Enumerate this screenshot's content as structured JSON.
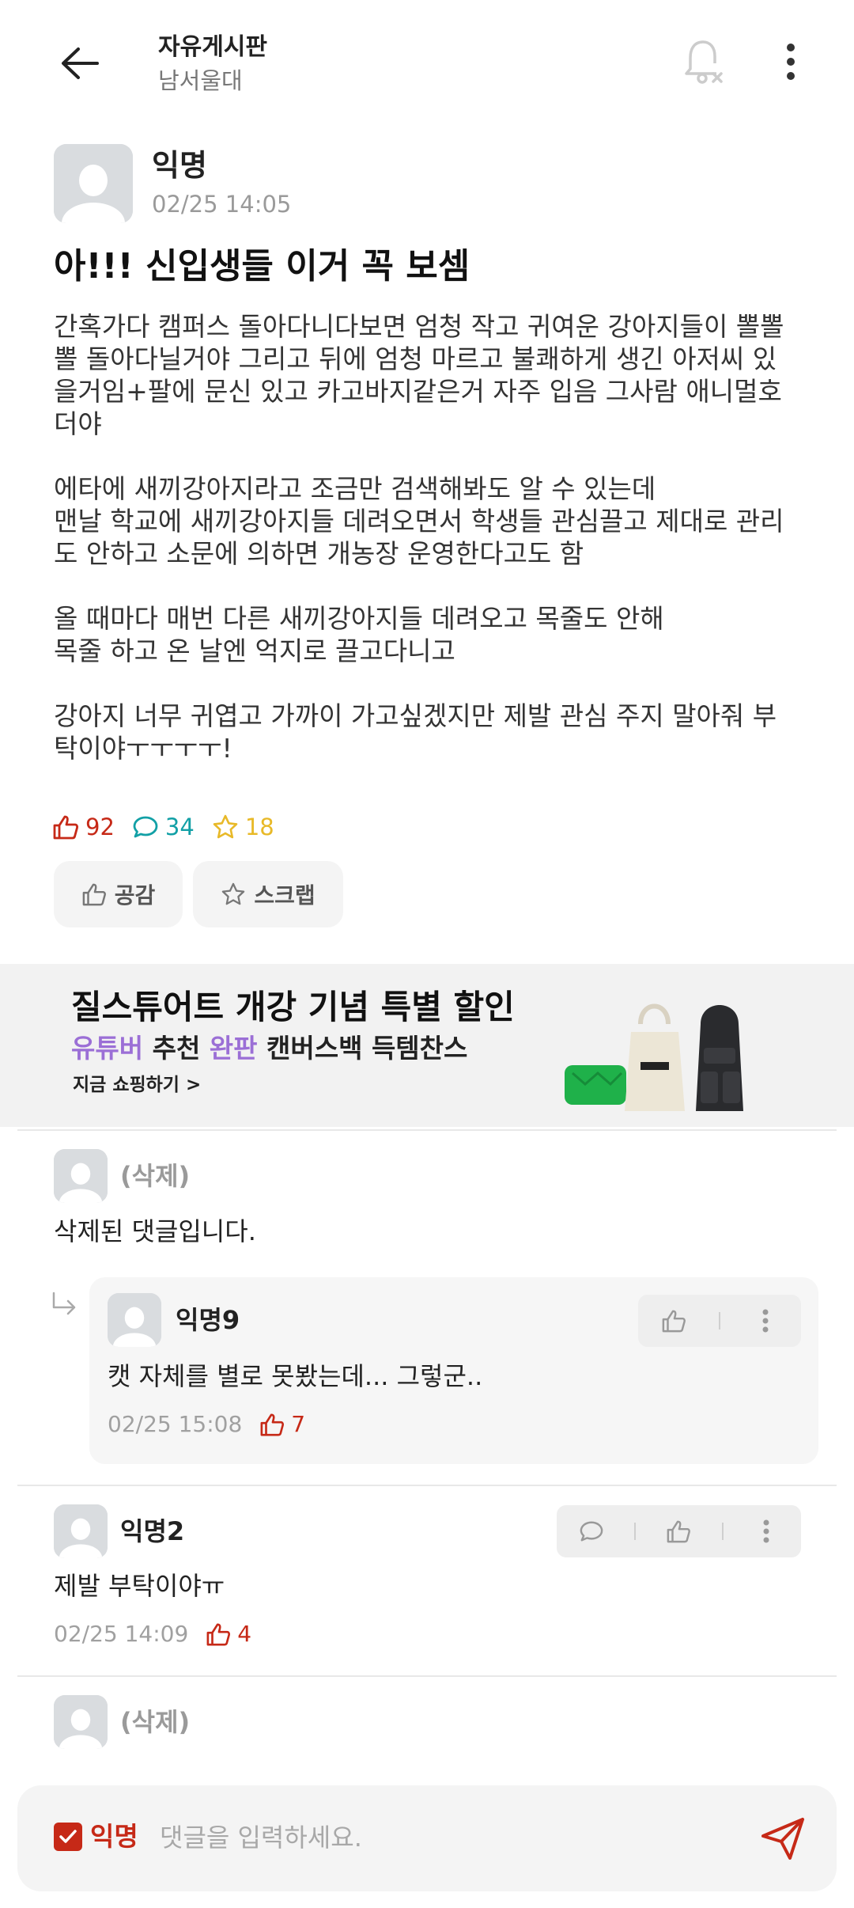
{
  "header": {
    "title": "자유게시판",
    "subtitle": "남서울대"
  },
  "post": {
    "author": "익명",
    "time": "02/25 14:05",
    "title": "아!!! 신입생들 이거 꼭 보셈",
    "body": "간혹가다 캠퍼스 돌아다니다보면 엄청 작고 귀여운 강아지들이 뽈뽈\n뽈 돌아다닐거야 그리고 뒤에 엄청 마르고 불쾌하게 생긴 아저씨 있\n을거임+팔에 문신 있고 카고바지같은거 자주 입음 그사람 애니멀호\n더야\n\n에타에 새끼강아지라고 조금만 검색해봐도 알 수 있는데\n맨날 학교에 새끼강아지들 데려오면서 학생들 관심끌고 제대로 관리\n도 안하고 소문에 의하면 개농장 운영한다고도 함\n\n올 때마다 매번 다른 새끼강아지들 데려오고 목줄도 안해\n목줄 하고 온 날엔 억지로 끌고다니고\n\n강아지 너무 귀엽고 가까이 가고싶겠지만 제발 관심 주지 말아줘 부\n탁이야ㅜㅜㅜㅜ!",
    "likes": "92",
    "comments": "34",
    "scraps": "18",
    "like_button": "공감",
    "scrap_button": "스크랩"
  },
  "ad": {
    "title": "질스튜어트 개강 기념 특별 할인",
    "sub_hl1": "유튜버",
    "sub_mid1": " 추천 ",
    "sub_hl2": "완판",
    "sub_rest": " 캔버스백 득템찬스",
    "link": "지금 쇼핑하기 >"
  },
  "comments": [
    {
      "name": "(삭제)",
      "text": "삭제된 댓글입니다."
    },
    {
      "name": "익명9",
      "text": "캣 자체를 별로 못봤는데... 그렇군..",
      "time": "02/25 15:08",
      "likes": "7"
    },
    {
      "name": "익명2",
      "text": "제발 부탁이야ㅠ",
      "time": "02/25 14:09",
      "likes": "4"
    },
    {
      "name": "(삭제)"
    }
  ],
  "composer": {
    "anon_label": "익명",
    "placeholder": "댓글을 입력하세요."
  },
  "colors": {
    "accent_red": "#c62917",
    "comment_teal": "#12a0a6",
    "scrap_yellow": "#e8b928",
    "ad_purple": "#9b6fd6"
  }
}
